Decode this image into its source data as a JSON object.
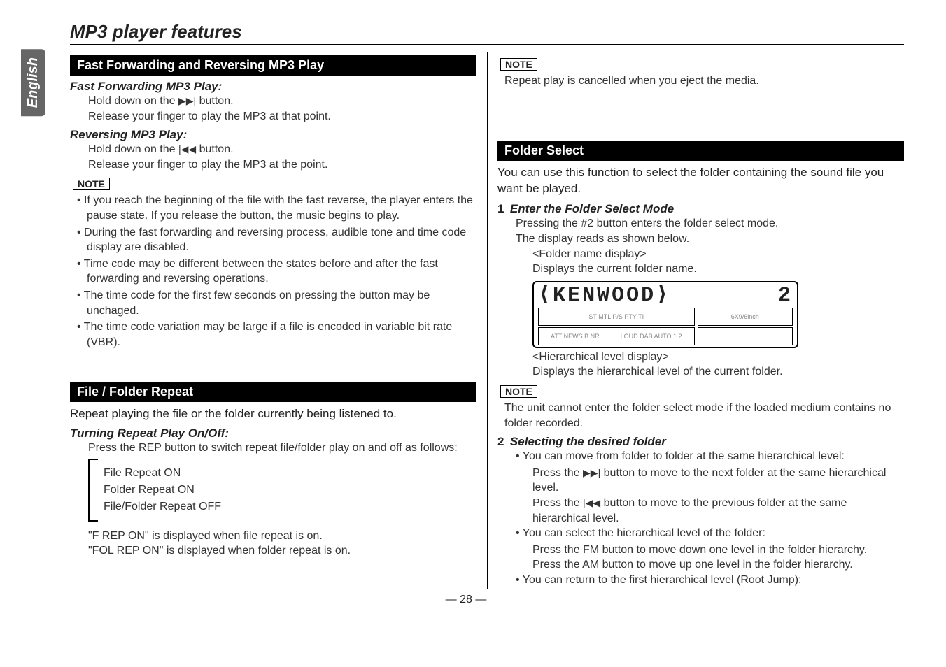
{
  "side_tab": "English",
  "page_title": "MP3 player features",
  "left": {
    "sec1_header": "Fast Forwarding and Reversing MP3 Play",
    "ff_title": "Fast Forwarding MP3 Play:",
    "ff_line1_pre": "Hold down on the ",
    "ff_line1_icon": "▶▶|",
    "ff_line1_post": " button.",
    "ff_line2": "Release your finger to play the MP3 at that point.",
    "rev_title": "Reversing MP3 Play:",
    "rev_line1_pre": "Hold down on the ",
    "rev_line1_icon": "|◀◀",
    "rev_line1_post": " button.",
    "rev_line2": "Release your finger to play the MP3 at the point.",
    "note_label": "NOTE",
    "notes1": [
      "If you reach the beginning of the file with the fast reverse, the player enters the pause state. If you release the button, the music begins to play.",
      "During the fast forwarding and reversing process, audible tone and time code display are disabled.",
      "Time code may be different between the states before and after the fast forwarding and reversing operations.",
      "The time code for the first few seconds on pressing the button may be unchaged.",
      "The time code variation may be large if a file is encoded in variable bit rate (VBR)."
    ],
    "sec2_header": "File / Folder Repeat",
    "sec2_intro": "Repeat playing the file or the folder currently being listened to.",
    "toggle_title": "Turning Repeat Play On/Off:",
    "toggle_body": "Press the REP button to switch repeat file/folder play on and off as follows:",
    "cycle": [
      "File Repeat ON",
      "Folder Repeat ON",
      "File/Folder Repeat OFF"
    ],
    "disp1": "\"F REP ON\" is displayed when file repeat is on.",
    "disp2": "\"FOL REP ON\" is displayed when folder repeat is on."
  },
  "right": {
    "note_label": "NOTE",
    "note_top": "Repeat play is cancelled when you eject the media.",
    "sec3_header": "Folder Select",
    "sec3_intro": "You can use this function to select the folder containing the sound file you want be played.",
    "step1_num": "1",
    "step1_title": "Enter the Folder Select Mode",
    "step1_l1": "Pressing the #2 button enters the folder select mode.",
    "step1_l2": "The display reads as shown below.",
    "caption_top1": "<Folder name display>",
    "caption_top2": "Displays the current folder name.",
    "lcd_main_left": "⟨KENWOOD⟩",
    "lcd_main_right": "2",
    "lcd_row_a": "ST  MTL  P/S  PTY  TI",
    "lcd_row_b": "ATT  NEWS  B.NR",
    "lcd_row_c": "LOUD  DAB  AUTO 1 2",
    "lcd_row_d": "6X9/6inch",
    "caption_bot1": "<Hierarchical level display>",
    "caption_bot2": "Displays the hierarchical level of the current folder.",
    "note2": "The unit cannot enter the folder select mode if the loaded medium contains no folder recorded.",
    "step2_num": "2",
    "step2_title": "Selecting the desired folder",
    "b1": "You can move from folder to folder at the same hierarchical level:",
    "b1a_pre": "Press the ",
    "b1a_icon": "▶▶|",
    "b1a_post": " button to move to the next folder at the same hierarchical level.",
    "b1b_pre": "Press the ",
    "b1b_icon": "|◀◀",
    "b1b_post": " button to move to the previous folder at the same hierarchical level.",
    "b2": "You can select the hierarchical level of the folder:",
    "b2a": "Press the FM button to move down one level in the folder hierarchy.",
    "b2b": "Press the AM button to move up one level in the folder hierarchy.",
    "b3": "You can return to the first hierarchical level (Root Jump):"
  },
  "page_number": "— 28 —"
}
